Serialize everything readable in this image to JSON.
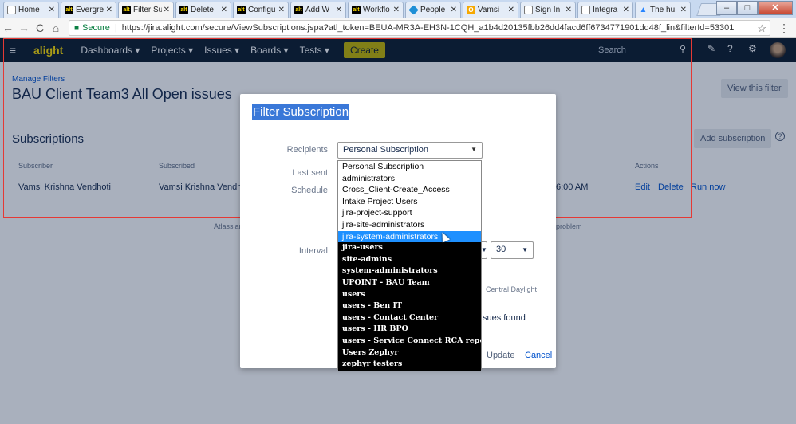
{
  "browser": {
    "tabs": [
      {
        "label": "Home",
        "icon": "doc-icon"
      },
      {
        "label": "Evergre",
        "icon": "alight-icon"
      },
      {
        "label": "Filter Su",
        "icon": "alight-icon",
        "active": true
      },
      {
        "label": "Delete",
        "icon": "alight-icon"
      },
      {
        "label": "Configu",
        "icon": "alight-icon"
      },
      {
        "label": "Add W",
        "icon": "alight-icon"
      },
      {
        "label": "Workflo",
        "icon": "alight-icon"
      },
      {
        "label": "People",
        "icon": "people-icon"
      },
      {
        "label": "Vamsi",
        "icon": "outlook-icon"
      },
      {
        "label": "Sign In",
        "icon": "doc-icon"
      },
      {
        "label": "Integra",
        "icon": "doc-icon"
      },
      {
        "label": "The hu",
        "icon": "atlassian-icon"
      }
    ],
    "secure_label": "Secure",
    "url": "https://jira.alight.com/secure/ViewSubscriptions.jspa?atl_token=BEUA-MR3A-EH3N-1CQH_a1b4d20135fbb26dd4facd6ff6734771901dd48f_lin&filterId=53301"
  },
  "jira_header": {
    "logo": "alight",
    "nav": [
      "Dashboards ▾",
      "Projects ▾",
      "Issues ▾",
      "Boards ▾",
      "Tests ▾"
    ],
    "create": "Create",
    "search_placeholder": "Search"
  },
  "page": {
    "breadcrumb": "Manage Filters",
    "title": "BAU Client Team3 All Open issues",
    "view_filter": "View this filter",
    "subscriptions_title": "Subscriptions",
    "add_subscription": "Add subscription",
    "columns": [
      "Subscriber",
      "Subscribed",
      "Actions"
    ],
    "row": {
      "subscriber": "Vamsi Krishna Vendhoti",
      "subscribed": "Vamsi Krishna Vendhoti",
      "time": "6:00 AM",
      "edit": "Edit",
      "delete": "Delete",
      "run": "Run now"
    },
    "footer_left": "Atlassian",
    "footer_right": "problem"
  },
  "dialog": {
    "title": "Filter Subscription",
    "recipients_label": "Recipients",
    "recipients_value": "Personal Subscription",
    "last_sent_label": "Last sent",
    "schedule_label": "Schedule",
    "interval_label": "Interval",
    "interval_value": "30",
    "tz_text": "Central Daylight",
    "issues_text": "sues found",
    "update": "Update",
    "cancel": "Cancel",
    "options": [
      "Personal Subscription",
      "administrators",
      "Cross_Client-Create_Access",
      "Intake Project Users",
      "jira-project-support",
      "jira-site-administrators",
      "jira-system-administrators",
      "jira-users",
      "site-admins",
      "system-administrators",
      "UPOINT - BAU Team",
      "users",
      "users - Ben IT",
      "users - Contact Center",
      "users - HR BPO",
      "users - Service Connect RCA reporting",
      "Users Zephyr",
      "zephyr testers"
    ],
    "highlighted_index": 6
  }
}
